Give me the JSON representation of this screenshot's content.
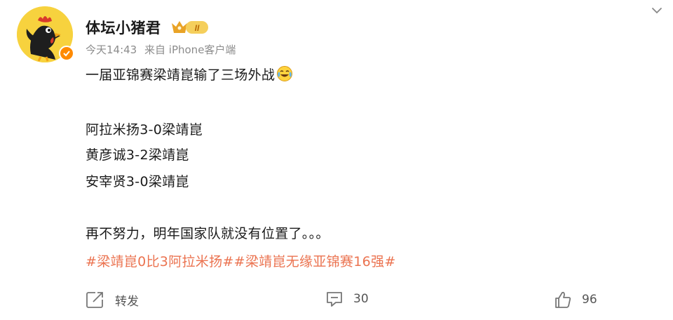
{
  "user": {
    "name": "体坛小猪君",
    "badge_text": "II"
  },
  "meta": {
    "time": "今天14:43",
    "source": "来自 iPhone客户端"
  },
  "post": {
    "line1": "一届亚锦赛梁靖崑输了三场外战",
    "line2": "阿拉米扬3-0梁靖崑",
    "line3": "黄彦诚3-2梁靖崑",
    "line4": "安宰贤3-0梁靖崑",
    "line5": "再不努力，明年国家队就没有位置了。。。",
    "hashtags": "#梁靖崑0比3阿拉米扬##梁靖崑无缘亚锦赛16强#"
  },
  "actions": {
    "share_label": "转发",
    "comment_count": "30",
    "like_count": "96"
  },
  "colors": {
    "hashtag": "#eb7350",
    "verified": "#ff8a00",
    "avatar_bg": "#f7d23e"
  },
  "icons": [
    "rooster-avatar",
    "verified-icon",
    "level-badge-icon",
    "chevron-down-icon",
    "crying-laugh-emoji",
    "share-icon",
    "comment-icon",
    "like-icon"
  ]
}
